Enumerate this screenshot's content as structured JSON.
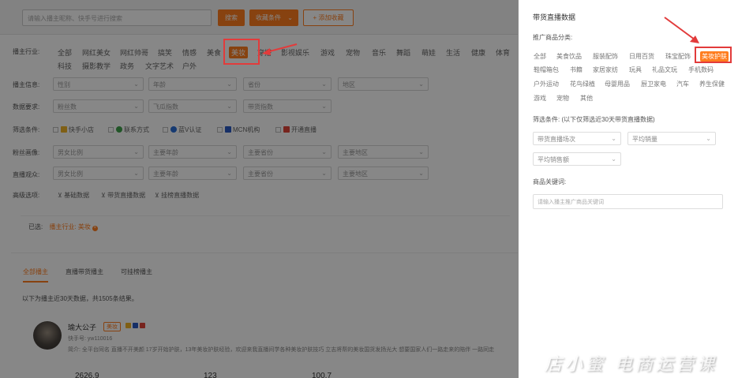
{
  "topbar": {
    "search_placeholder": "请输入播主昵称、快手号进行搜索",
    "search_button": "搜索",
    "favorites_button": "收藏条件",
    "add_favorite_button": "+ 添加收藏"
  },
  "filters": {
    "industry_label": "播主行业:",
    "industry_tags": [
      "全部",
      "网红美女",
      "网红帅哥",
      "搞笑",
      "情感",
      "美食",
      "美妆",
      "穿搭",
      "影视娱乐",
      "游戏",
      "宠物",
      "音乐",
      "舞蹈",
      "萌娃",
      "生活",
      "健康",
      "体育",
      "科技",
      "摄影教学",
      "政务",
      "文字艺术",
      "户外"
    ],
    "industry_active": "美妆",
    "anchor_info_label": "播主信息:",
    "anchor_info_selects": [
      "性别",
      "年龄",
      "省份",
      "地区"
    ],
    "data_label": "数据要求:",
    "data_selects": [
      "粉丝数",
      "飞瓜指数",
      "带货指数"
    ],
    "filter_label": "筛选条件:",
    "filter_checks": [
      "快手小店",
      "联系方式",
      "蓝V认证",
      "MCN机构",
      "开通直播"
    ],
    "fans_label": "粉丝画像:",
    "fans_selects": [
      "男女比例",
      "主要年龄",
      "主要省份",
      "主要地区"
    ],
    "viewer_label": "直播观众:",
    "viewer_selects": [
      "男女比例",
      "主要年龄",
      "主要省份",
      "主要地区"
    ],
    "advanced_label": "高级选项:",
    "advanced_options": [
      "基础数据",
      "带货直播数据",
      "挂榜直播数据"
    ],
    "selected_label": "已选:",
    "selected_chip": "播主行业: 美妆"
  },
  "tabs": {
    "items": [
      "全部播主",
      "直播带货播主",
      "可挂榜播主"
    ],
    "result_text": "以下为播主近30天数据，共1505条结果。"
  },
  "anchor": {
    "name": "瑜大公子",
    "badge": "美妆",
    "id_text": "快手号: yw110016",
    "intro": "简介: 全平台同名 直播不开美颜 17岁开始护肤，13年美妆护肤经验，欢迎来我直播间学各种美妆护肤技巧 立志将帮的美妆国货发扬光大 想要国家人们一路走来的陪伴 一路同走",
    "stats": [
      "2626.9",
      "123",
      "100.7"
    ]
  },
  "drawer": {
    "title": "带货直播数据",
    "category_label": "推广商品分类:",
    "categories": [
      "全部",
      "美食饮品",
      "服装配饰",
      "日用百货",
      "珠宝配饰",
      "美妆护肤",
      "鞋帽箱包",
      "书籍",
      "家居家纺",
      "玩具",
      "礼品文玩",
      "手机数码",
      "户外运动",
      "花鸟绿植",
      "母婴用品",
      "厨卫家电",
      "汽车",
      "养生保健",
      "游戏",
      "宠物",
      "其他"
    ],
    "category_active": "美妆护肤",
    "filter_label": "筛选条件: (以下仅筛选近30天带货直播数据)",
    "filter_selects": [
      "带货直播场次",
      "平均销量",
      "平均销售额"
    ],
    "keyword_label": "商品关键词:",
    "keyword_placeholder": "请输入播主推广商品关键词"
  },
  "watermark": {
    "text_a": "店小",
    "text_b": "蜜 电商运营课"
  },
  "colors": {
    "accent": "#ff7d1f",
    "annotation_red": "#e23b3b"
  }
}
